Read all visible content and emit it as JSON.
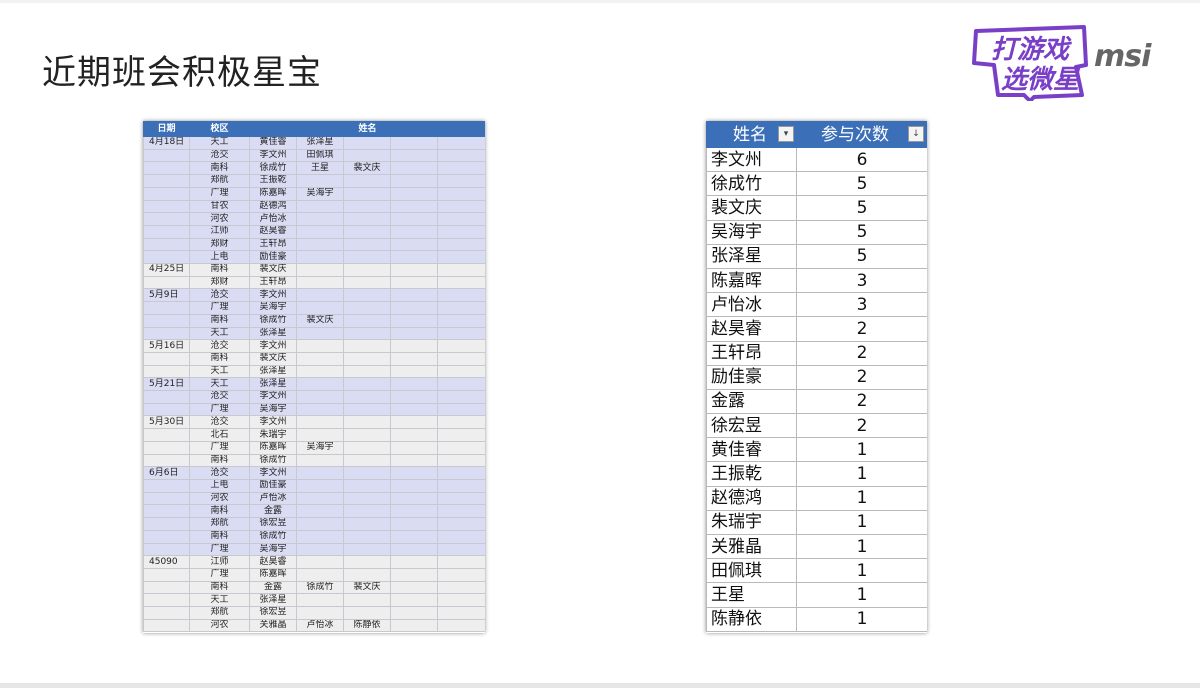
{
  "slide": {
    "title": "近期班会积极星宝",
    "logo_game_line1": "打游戏",
    "logo_game_line2": "选微星",
    "logo_msi": "msi"
  },
  "left_table": {
    "headers": [
      "日期",
      "校区",
      "姓名"
    ],
    "rows": [
      {
        "g": 1,
        "cells": [
          "4月18日",
          "天工",
          "黄佳睿",
          "张泽星",
          "",
          "",
          ""
        ]
      },
      {
        "g": 1,
        "cells": [
          "",
          "沧交",
          "李文州",
          "田佩琪",
          "",
          "",
          ""
        ]
      },
      {
        "g": 1,
        "cells": [
          "",
          "南科",
          "徐成竹",
          "王星",
          "裴文庆",
          "",
          ""
        ]
      },
      {
        "g": 1,
        "cells": [
          "",
          "郑航",
          "王振乾",
          "",
          "",
          "",
          ""
        ]
      },
      {
        "g": 1,
        "cells": [
          "",
          "广理",
          "陈嘉晖",
          "吴海宇",
          "",
          "",
          ""
        ]
      },
      {
        "g": 1,
        "cells": [
          "",
          "甘农",
          "赵德鸿",
          "",
          "",
          "",
          ""
        ]
      },
      {
        "g": 1,
        "cells": [
          "",
          "河农",
          "卢怡冰",
          "",
          "",
          "",
          ""
        ]
      },
      {
        "g": 1,
        "cells": [
          "",
          "江师",
          "赵昊睿",
          "",
          "",
          "",
          ""
        ]
      },
      {
        "g": 1,
        "cells": [
          "",
          "郑财",
          "王轩昂",
          "",
          "",
          "",
          ""
        ]
      },
      {
        "g": 1,
        "cells": [
          "",
          "上电",
          "励佳豪",
          "",
          "",
          "",
          ""
        ]
      },
      {
        "g": 2,
        "cells": [
          "4月25日",
          "南科",
          "裴文庆",
          "",
          "",
          "",
          ""
        ]
      },
      {
        "g": 2,
        "cells": [
          "",
          "郑财",
          "王轩昂",
          "",
          "",
          "",
          ""
        ]
      },
      {
        "g": 1,
        "cells": [
          "5月9日",
          "沧交",
          "李文州",
          "",
          "",
          "",
          ""
        ]
      },
      {
        "g": 1,
        "cells": [
          "",
          "广理",
          "吴海宇",
          "",
          "",
          "",
          ""
        ]
      },
      {
        "g": 1,
        "cells": [
          "",
          "南科",
          "徐成竹",
          "裴文庆",
          "",
          "",
          ""
        ]
      },
      {
        "g": 1,
        "cells": [
          "",
          "天工",
          "张泽星",
          "",
          "",
          "",
          ""
        ]
      },
      {
        "g": 2,
        "cells": [
          "5月16日",
          "沧交",
          "李文州",
          "",
          "",
          "",
          ""
        ]
      },
      {
        "g": 2,
        "cells": [
          "",
          "南科",
          "裴文庆",
          "",
          "",
          "",
          ""
        ]
      },
      {
        "g": 2,
        "cells": [
          "",
          "天工",
          "张泽星",
          "",
          "",
          "",
          ""
        ]
      },
      {
        "g": 1,
        "cells": [
          "5月21日",
          "天工",
          "张泽星",
          "",
          "",
          "",
          ""
        ]
      },
      {
        "g": 1,
        "cells": [
          "",
          "沧交",
          "李文州",
          "",
          "",
          "",
          ""
        ]
      },
      {
        "g": 1,
        "cells": [
          "",
          "广理",
          "吴海宇",
          "",
          "",
          "",
          ""
        ]
      },
      {
        "g": 2,
        "cells": [
          "5月30日",
          "沧交",
          "李文州",
          "",
          "",
          "",
          ""
        ]
      },
      {
        "g": 2,
        "cells": [
          "",
          "北石",
          "朱瑞宇",
          "",
          "",
          "",
          ""
        ]
      },
      {
        "g": 2,
        "cells": [
          "",
          "广理",
          "陈嘉晖",
          "吴海宇",
          "",
          "",
          ""
        ]
      },
      {
        "g": 2,
        "cells": [
          "",
          "南科",
          "徐成竹",
          "",
          "",
          "",
          ""
        ]
      },
      {
        "g": 1,
        "cells": [
          "6月6日",
          "沧交",
          "李文州",
          "",
          "",
          "",
          ""
        ]
      },
      {
        "g": 1,
        "cells": [
          "",
          "上电",
          "励佳豪",
          "",
          "",
          "",
          ""
        ]
      },
      {
        "g": 1,
        "cells": [
          "",
          "河农",
          "卢怡冰",
          "",
          "",
          "",
          ""
        ]
      },
      {
        "g": 1,
        "cells": [
          "",
          "南科",
          "金露",
          "",
          "",
          "",
          ""
        ]
      },
      {
        "g": 1,
        "cells": [
          "",
          "郑航",
          "徐宏昱",
          "",
          "",
          "",
          ""
        ]
      },
      {
        "g": 1,
        "cells": [
          "",
          "南科",
          "徐成竹",
          "",
          "",
          "",
          ""
        ]
      },
      {
        "g": 1,
        "cells": [
          "",
          "广理",
          "吴海宇",
          "",
          "",
          "",
          ""
        ]
      },
      {
        "g": 2,
        "cells": [
          "45090",
          "江师",
          "赵昊睿",
          "",
          "",
          "",
          ""
        ]
      },
      {
        "g": 2,
        "cells": [
          "",
          "广理",
          "陈嘉晖",
          "",
          "",
          "",
          ""
        ]
      },
      {
        "g": 2,
        "cells": [
          "",
          "南科",
          "金露",
          "徐成竹",
          "裴文庆",
          "",
          ""
        ]
      },
      {
        "g": 2,
        "cells": [
          "",
          "天工",
          "张泽星",
          "",
          "",
          "",
          ""
        ]
      },
      {
        "g": 2,
        "cells": [
          "",
          "郑航",
          "徐宏昱",
          "",
          "",
          "",
          ""
        ]
      },
      {
        "g": 2,
        "cells": [
          "",
          "河农",
          "关雅晶",
          "卢怡冰",
          "陈静依",
          "",
          ""
        ]
      }
    ]
  },
  "right_table": {
    "headers": [
      "姓名",
      "参与次数"
    ],
    "filter_icon_name": "filter-dropdown-icon",
    "sort_icon_name": "sort-descending-icon",
    "rows": [
      {
        "name": "李文州",
        "count": "6"
      },
      {
        "name": "徐成竹",
        "count": "5"
      },
      {
        "name": "裴文庆",
        "count": "5"
      },
      {
        "name": "吴海宇",
        "count": "5"
      },
      {
        "name": "张泽星",
        "count": "5"
      },
      {
        "name": "陈嘉晖",
        "count": "3"
      },
      {
        "name": "卢怡冰",
        "count": "3"
      },
      {
        "name": "赵昊睿",
        "count": "2"
      },
      {
        "name": "王轩昂",
        "count": "2"
      },
      {
        "name": "励佳豪",
        "count": "2"
      },
      {
        "name": "金露",
        "count": "2"
      },
      {
        "name": "徐宏昱",
        "count": "2"
      },
      {
        "name": "黄佳睿",
        "count": "1"
      },
      {
        "name": "王振乾",
        "count": "1"
      },
      {
        "name": "赵德鸿",
        "count": "1"
      },
      {
        "name": "朱瑞宇",
        "count": "1"
      },
      {
        "name": "关雅晶",
        "count": "1"
      },
      {
        "name": "田佩琪",
        "count": "1"
      },
      {
        "name": "王星",
        "count": "1"
      },
      {
        "name": "陈静依",
        "count": "1"
      }
    ]
  },
  "colors": {
    "header_blue": "#3b6fb8",
    "group_lavender": "#d9dcf3",
    "group_gray": "#eeeeee",
    "logo_purple": "#7a3fc7"
  }
}
